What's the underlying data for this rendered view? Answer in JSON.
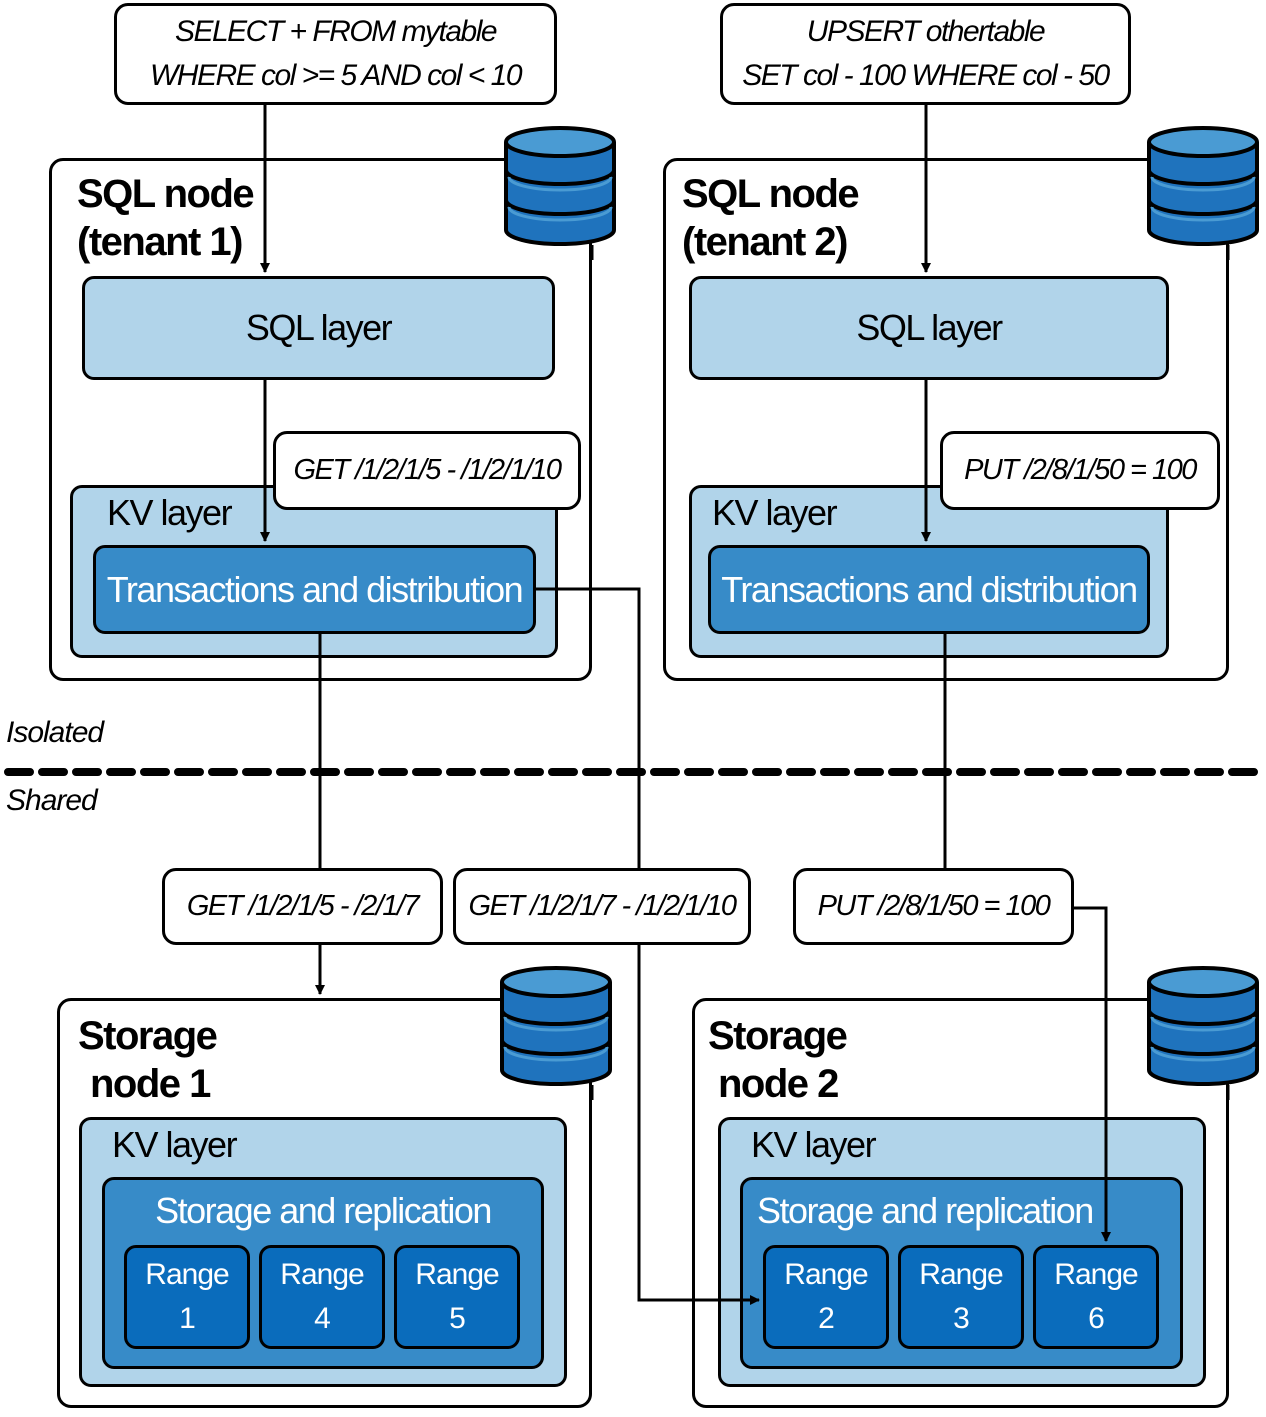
{
  "queries": {
    "tenant1": {
      "line1": "SELECT + FROM mytable",
      "line2": "WHERE col >= 5 AND col < 10"
    },
    "tenant2": {
      "line1": "UPSERT othertable",
      "line2": "SET col -  100 WHERE col - 50"
    }
  },
  "sql_nodes": [
    {
      "title_line1": "SQL node",
      "title_line2": "(tenant 1)",
      "sql_layer": "SQL layer",
      "kv_layer": "KV layer",
      "txn": "Transactions and distribution",
      "request": "GET /1/2/1/5 - /1/2/1/10"
    },
    {
      "title_line1": "SQL node",
      "title_line2": "(tenant 2)",
      "sql_layer": "SQL layer",
      "kv_layer": "KV layer",
      "txn": "Transactions and distribution",
      "request": "PUT /2/8/1/50 = 100"
    }
  ],
  "divider": {
    "above": "Isolated",
    "below": "Shared"
  },
  "requests": {
    "get_a": "GET /1/2/1/5 - /2/1/7",
    "get_b": "GET /1/2/1/7 - /1/2/1/10",
    "put": "PUT /2/8/1/50 = 100"
  },
  "storage_nodes": [
    {
      "title_line1": "Storage",
      "title_line2": "node 1",
      "kv_layer": "KV layer",
      "storage": "Storage and replication",
      "ranges": [
        {
          "label": "Range",
          "num": "1"
        },
        {
          "label": "Range",
          "num": "4"
        },
        {
          "label": "Range",
          "num": "5"
        }
      ]
    },
    {
      "title_line1": "Storage",
      "title_line2": "node 2",
      "kv_layer": "KV layer",
      "storage": "Storage and replication",
      "ranges": [
        {
          "label": "Range",
          "num": "2"
        },
        {
          "label": "Range",
          "num": "3"
        },
        {
          "label": "Range",
          "num": "6"
        }
      ]
    }
  ],
  "colors": {
    "light": "#b1d4ea",
    "mid": "#378bc8",
    "dark": "#0a6cbc",
    "db_top": "#4a9bd3",
    "db_body": "#1f73bd"
  }
}
